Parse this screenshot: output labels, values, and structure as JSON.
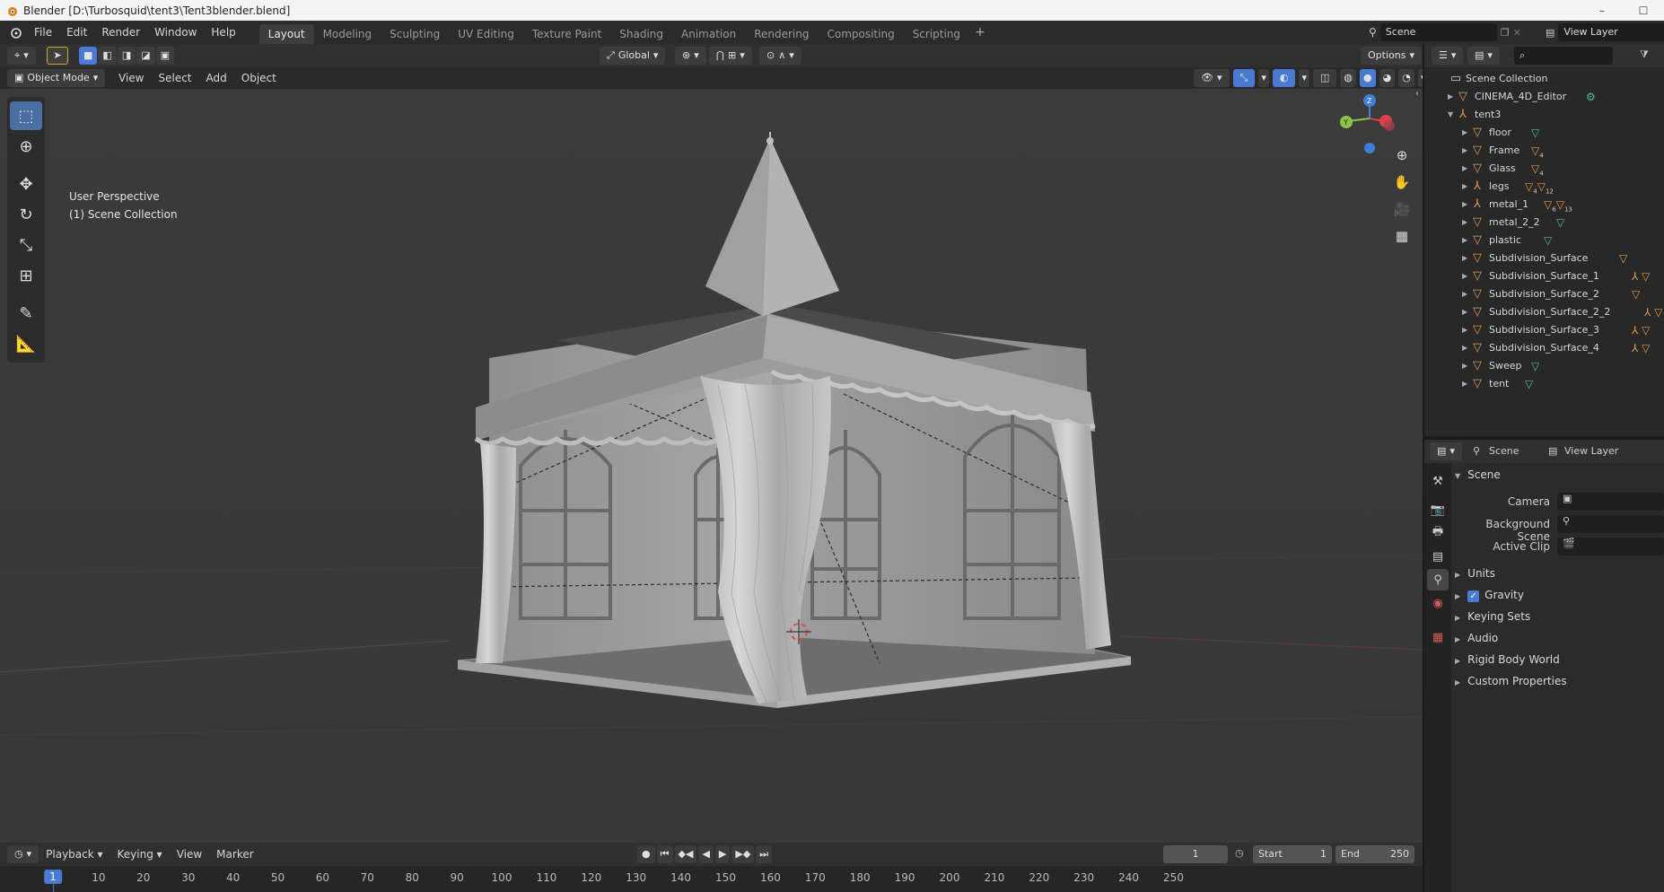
{
  "window": {
    "title": "Blender [D:\\Turbosquid\\tent3\\Tent3blender.blend]"
  },
  "menu": [
    "File",
    "Edit",
    "Render",
    "Window",
    "Help"
  ],
  "workspaces": [
    {
      "label": "Layout",
      "active": true
    },
    {
      "label": "Modeling"
    },
    {
      "label": "Sculpting"
    },
    {
      "label": "UV Editing"
    },
    {
      "label": "Texture Paint"
    },
    {
      "label": "Shading"
    },
    {
      "label": "Animation"
    },
    {
      "label": "Rendering"
    },
    {
      "label": "Compositing"
    },
    {
      "label": "Scripting"
    }
  ],
  "scene_selector": {
    "value": "Scene"
  },
  "view_layer_selector": {
    "value": "View Layer"
  },
  "viewport_header": {
    "orientation": "Global",
    "options_label": "Options"
  },
  "viewport_header2": {
    "mode": "Object Mode",
    "menus": [
      "View",
      "Select",
      "Add",
      "Object"
    ]
  },
  "viewport_info": {
    "line1": "User Perspective",
    "line2": "(1) Scene Collection"
  },
  "gizmo": {
    "z": "Z",
    "y": "Y"
  },
  "timeline": {
    "menus": [
      "Playback",
      "Keying",
      "View",
      "Marker"
    ],
    "current_frame": "1",
    "start_label": "Start",
    "start": "1",
    "end_label": "End",
    "end": "250",
    "ticks": [
      "1",
      "10",
      "20",
      "30",
      "40",
      "50",
      "60",
      "70",
      "80",
      "90",
      "100",
      "110",
      "120",
      "130",
      "140",
      "150",
      "160",
      "170",
      "180",
      "190",
      "200",
      "210",
      "220",
      "230",
      "240",
      "250"
    ]
  },
  "outliner": {
    "root": "Scene Collection",
    "items": [
      {
        "name": "CINEMA_4D_Editor",
        "depth": 1
      },
      {
        "name": "tent3",
        "depth": 1
      },
      {
        "name": "floor",
        "depth": 2
      },
      {
        "name": "Frame",
        "depth": 2,
        "sub": "4"
      },
      {
        "name": "Glass",
        "depth": 2,
        "sub": "4"
      },
      {
        "name": "legs",
        "depth": 2,
        "sub": "4",
        "sub2": "12"
      },
      {
        "name": "metal_1",
        "depth": 2,
        "sub": "6",
        "sub2": "13"
      },
      {
        "name": "metal_2_2",
        "depth": 2
      },
      {
        "name": "plastic",
        "depth": 2
      },
      {
        "name": "Subdivision_Surface",
        "depth": 2
      },
      {
        "name": "Subdivision_Surface_1",
        "depth": 2
      },
      {
        "name": "Subdivision_Surface_2",
        "depth": 2
      },
      {
        "name": "Subdivision_Surface_2_2",
        "depth": 2
      },
      {
        "name": "Subdivision_Surface_3",
        "depth": 2
      },
      {
        "name": "Subdivision_Surface_4",
        "depth": 2
      },
      {
        "name": "Sweep",
        "depth": 2
      },
      {
        "name": "tent",
        "depth": 2
      }
    ]
  },
  "properties": {
    "tab_scene": "Scene",
    "tab_view_layer": "View Layer",
    "panel_title": "Scene",
    "fields": [
      {
        "label": "Camera"
      },
      {
        "label": "Background Scene"
      },
      {
        "label": "Active Clip"
      }
    ],
    "panels": [
      "Units",
      "Gravity",
      "Keying Sets",
      "Audio",
      "Rigid Body World",
      "Custom Properties"
    ]
  },
  "colors": {
    "accent": "#4a7ad1",
    "object_orange": "#e59a4c",
    "mesh_teal": "#4fbd9a",
    "gizmo_x": "#e0404c",
    "gizmo_y": "#8bc34a",
    "gizmo_z": "#3f7fd9"
  }
}
